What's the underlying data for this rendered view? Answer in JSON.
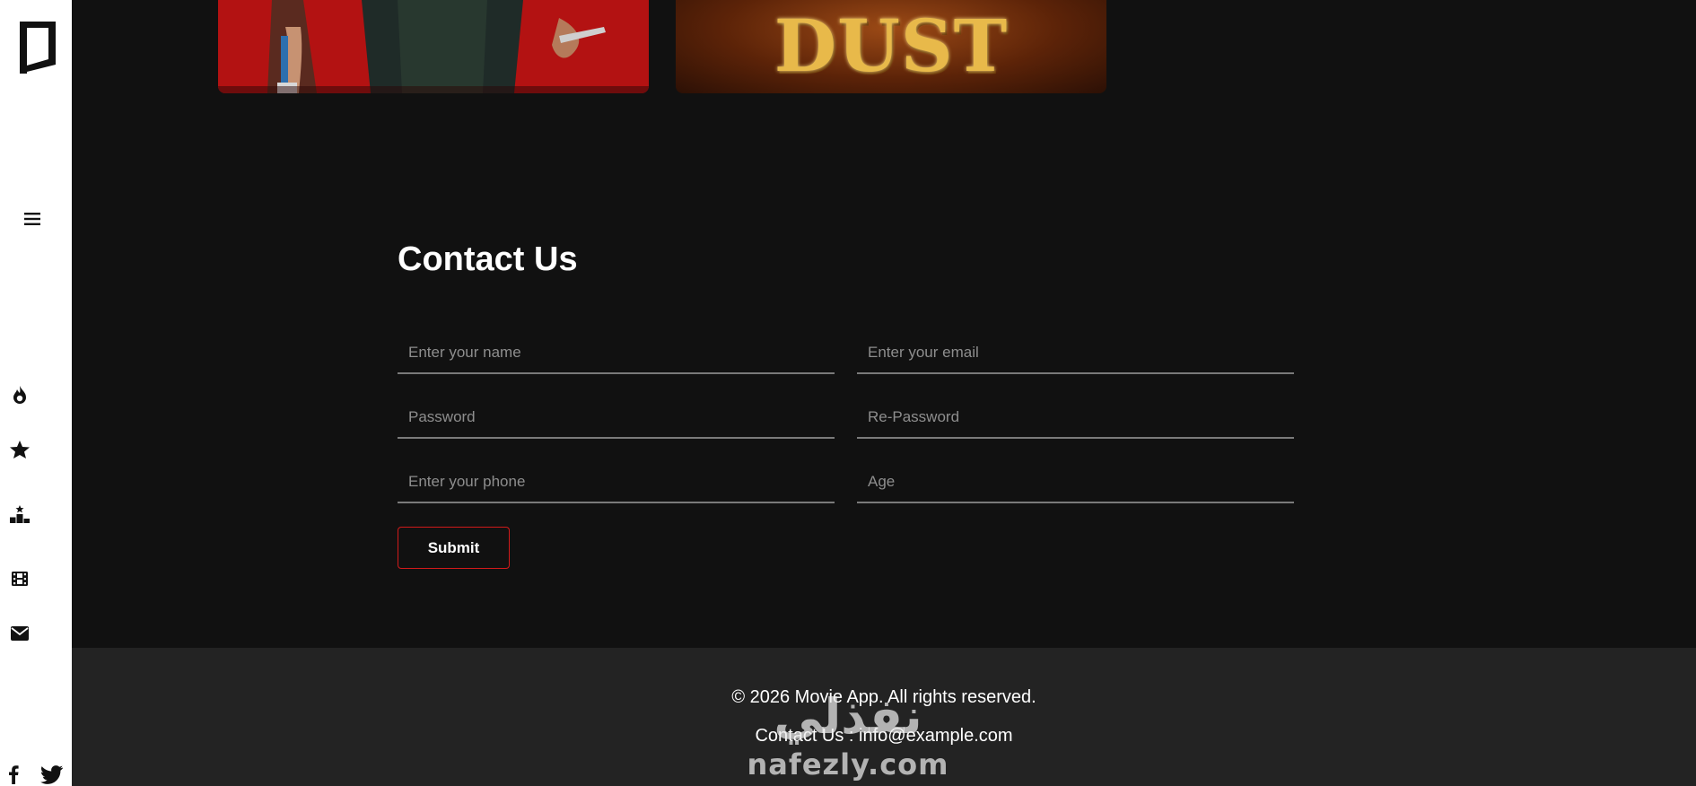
{
  "posters": [
    {
      "title": ""
    },
    {
      "title": "DUST BUNNY"
    }
  ],
  "contact": {
    "title": "Contact Us",
    "fields": {
      "name": {
        "placeholder": "Enter your name",
        "value": ""
      },
      "email": {
        "placeholder": "Enter your email",
        "value": ""
      },
      "password": {
        "placeholder": "Password",
        "value": ""
      },
      "repassword": {
        "placeholder": "Re-Password",
        "value": ""
      },
      "phone": {
        "placeholder": "Enter your phone",
        "value": ""
      },
      "age": {
        "placeholder": "Age",
        "value": ""
      }
    },
    "submit_label": "Submit"
  },
  "footer": {
    "copyright": "© 2026 Movie App. All rights reserved.",
    "contact": "Contact Us : info@example.com"
  },
  "watermark": {
    "arabic": "نفذلي",
    "latin": "nafezly.com"
  },
  "sidebar": {
    "logo": "logo-icon",
    "menu": "hamburger-icon",
    "nav": [
      "fire-icon",
      "star-icon",
      "ranking-icon",
      "film-icon",
      "envelope-icon"
    ],
    "social": [
      "facebook-icon",
      "twitter-icon"
    ]
  },
  "colors": {
    "background": "#111111",
    "sidebar": "#ffffff",
    "footer": "#232323",
    "accent": "#d11a1a"
  }
}
